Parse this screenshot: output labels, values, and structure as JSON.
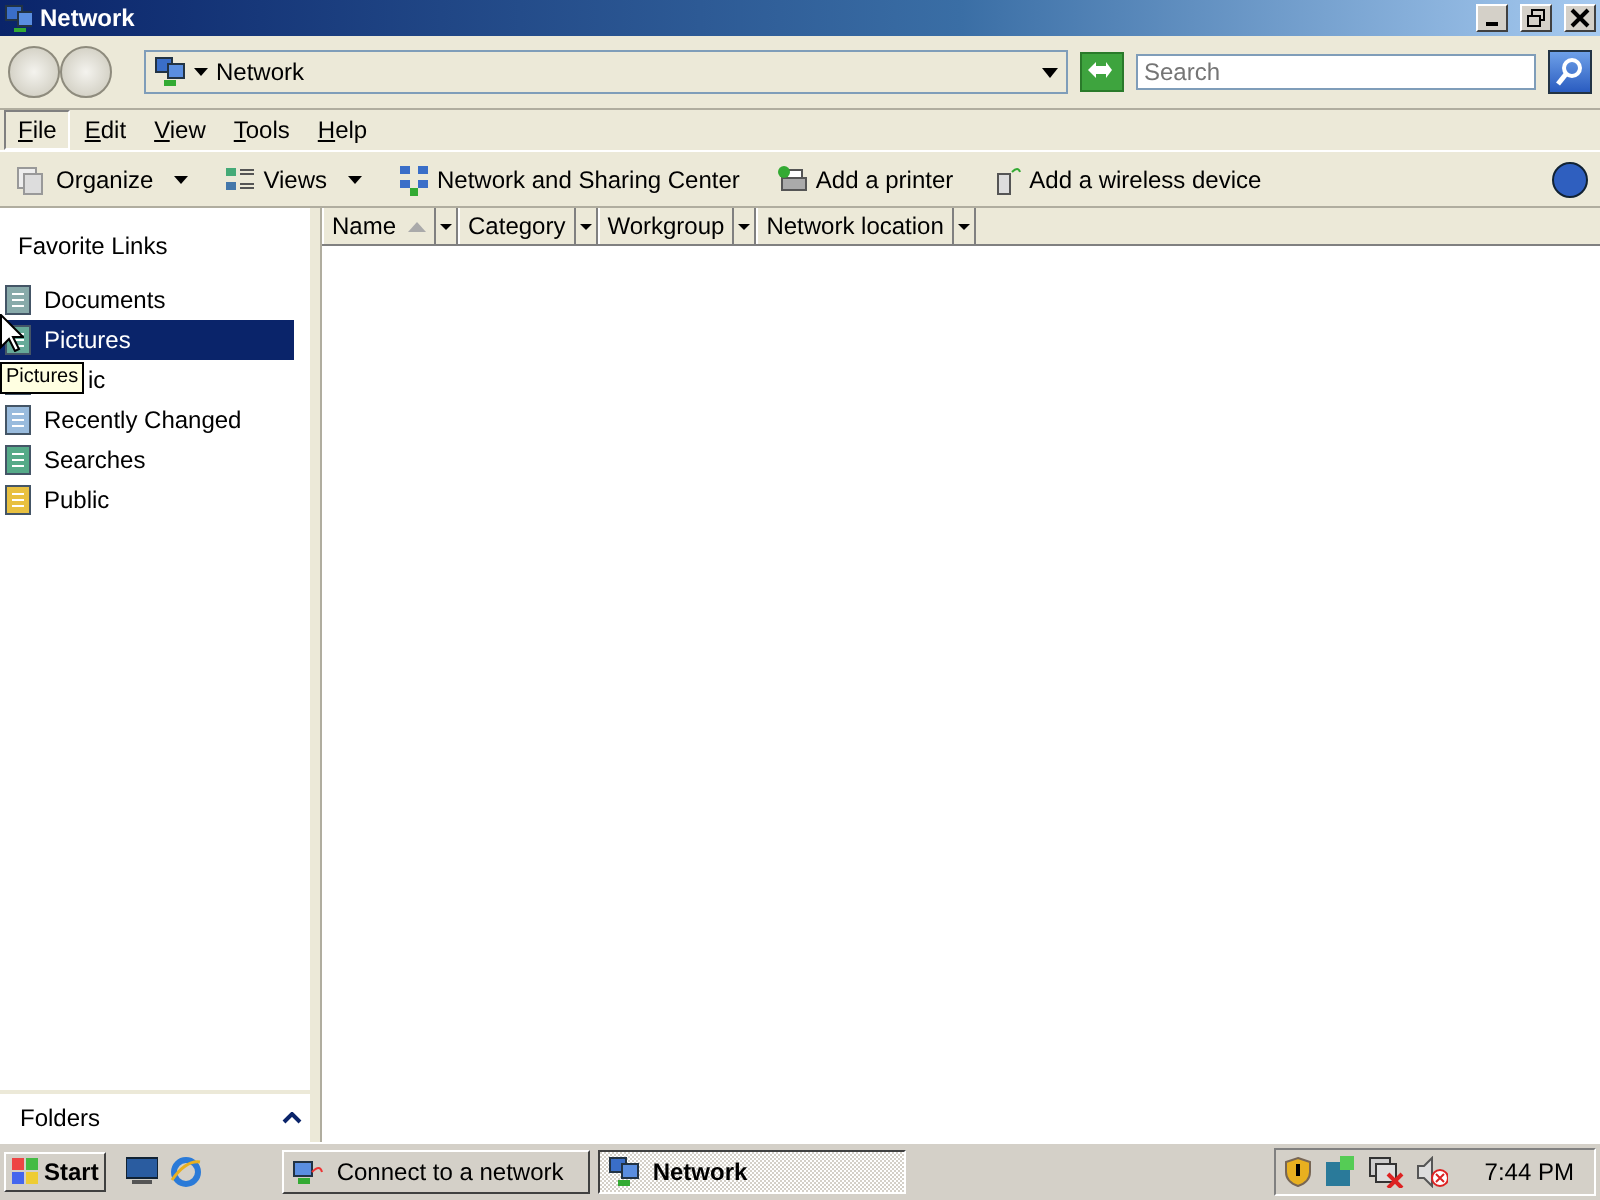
{
  "window": {
    "title": "Network"
  },
  "address": {
    "location": "Network"
  },
  "search": {
    "placeholder": "Search"
  },
  "menu": [
    {
      "label": "File",
      "selected": true
    },
    {
      "label": "Edit",
      "selected": false
    },
    {
      "label": "View",
      "selected": false
    },
    {
      "label": "Tools",
      "selected": false
    },
    {
      "label": "Help",
      "selected": false
    }
  ],
  "toolbar": [
    {
      "label": "Organize",
      "kind": "organize"
    },
    {
      "label": "Views",
      "kind": "views"
    },
    {
      "label": "Network and Sharing Center",
      "kind": "network"
    },
    {
      "label": "Add a printer",
      "kind": "printer"
    },
    {
      "label": "Add a wireless device",
      "kind": "wireless"
    }
  ],
  "nav": {
    "title": "Favorite Links",
    "items": [
      {
        "label": "Documents",
        "kind": "documents",
        "selected": false
      },
      {
        "label": "Pictures",
        "kind": "pictures",
        "selected": true
      },
      {
        "label": "ic",
        "kind": "music",
        "selected": false
      },
      {
        "label": "Recently Changed",
        "kind": "recent",
        "selected": false
      },
      {
        "label": "Searches",
        "kind": "searches",
        "selected": false
      },
      {
        "label": "Public",
        "kind": "public",
        "selected": false
      }
    ],
    "tooltip": "Pictures",
    "footer": "Folders"
  },
  "columns": [
    {
      "label": "Name",
      "sorted": true
    },
    {
      "label": "Category",
      "sorted": false
    },
    {
      "label": "Workgroup",
      "sorted": false
    },
    {
      "label": "Network location",
      "sorted": false
    }
  ],
  "taskbar": {
    "start": "Start",
    "tasks": [
      {
        "label": "Connect to a network",
        "kind": "connect",
        "selected": false
      },
      {
        "label": "Network",
        "kind": "network",
        "selected": true
      }
    ],
    "clock": "7:44 PM"
  }
}
